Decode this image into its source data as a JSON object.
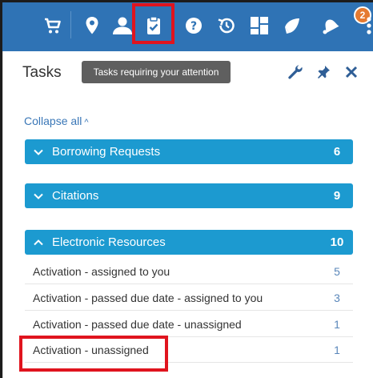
{
  "toolbar": {
    "icons": [
      "cart-icon",
      "location-pin-icon",
      "user-icon",
      "clipboard-check-icon",
      "help-icon",
      "history-icon",
      "widgets-icon",
      "megaphone-icon",
      "bell-icon",
      "more-icon"
    ],
    "notification_count": "2"
  },
  "panel": {
    "title": "Tasks",
    "tooltip": "Tasks requiring your attention",
    "collapse_all": "Collapse all",
    "header_icons": [
      "wrench-icon",
      "pin-icon",
      "close-icon"
    ]
  },
  "sections": [
    {
      "label": "Borrowing Requests",
      "count": "6",
      "expanded": false
    },
    {
      "label": "Citations",
      "count": "9",
      "expanded": false
    },
    {
      "label": "Electronic Resources",
      "count": "10",
      "expanded": true,
      "tasks": [
        {
          "label": "Activation - assigned to you",
          "count": "5"
        },
        {
          "label": "Activation - passed due date - assigned to you",
          "count": "3"
        },
        {
          "label": "Activation - passed due date - unassigned",
          "count": "1"
        },
        {
          "label": "Activation - unassigned",
          "count": "1"
        }
      ]
    }
  ],
  "colors": {
    "toolbar_bg": "#2f73b5",
    "section_bg": "#1c9ad0",
    "highlight": "#e0141e",
    "badge": "#e57a30",
    "link": "#3a77b7"
  }
}
